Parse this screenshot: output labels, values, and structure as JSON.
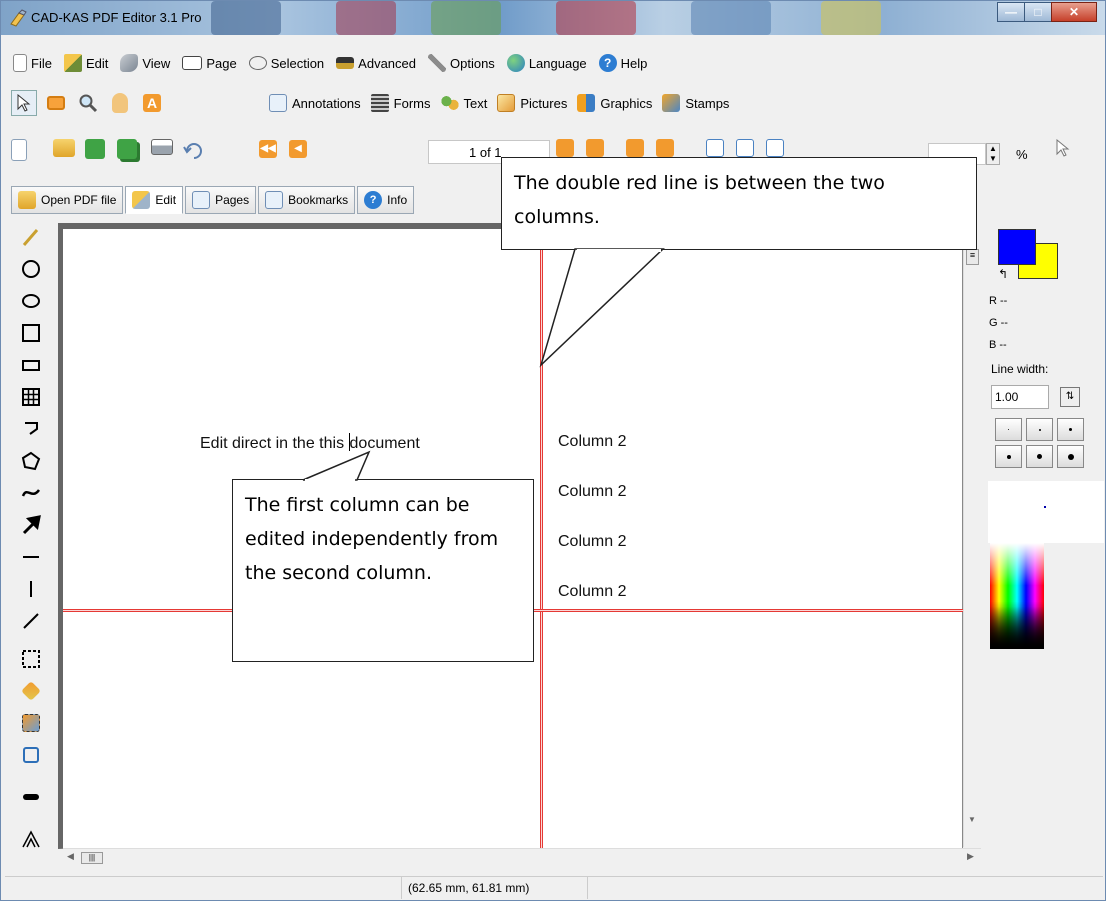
{
  "window": {
    "title": "CAD-KAS PDF Editor 3.1 Pro"
  },
  "menu": [
    "File",
    "Edit",
    "View",
    "Page",
    "Selection",
    "Advanced",
    "Options",
    "Language",
    "Help"
  ],
  "toolbar2": {
    "items": [
      "Annotations",
      "Forms",
      "Text",
      "Pictures",
      "Graphics",
      "Stamps"
    ]
  },
  "toolbar3": {
    "page_indicator": "1 of 1",
    "zoom_unit": "%"
  },
  "tabs": [
    "Open PDF file",
    "Edit",
    "Pages",
    "Bookmarks",
    "Info"
  ],
  "document": {
    "col1_before_cursor": "Edit direct in the this ",
    "col1_after_cursor": "document",
    "col2_lines": [
      "Column 2",
      "Column 2",
      "Column 2",
      "Column 2"
    ]
  },
  "right_panel": {
    "r": "R --",
    "g": "G --",
    "b": "B --",
    "line_width_label": "Line width:",
    "line_width_value": "1.00",
    "fg_color": "#0000ff",
    "bg_color": "#ffff00"
  },
  "status": {
    "coords": "(62.65 mm, 61.81 mm)"
  },
  "callouts": {
    "top": "The double red line is between the two columns.",
    "left": "The first column can be edited independently from the second column."
  },
  "colors": {
    "divider_line": "#e53935"
  }
}
